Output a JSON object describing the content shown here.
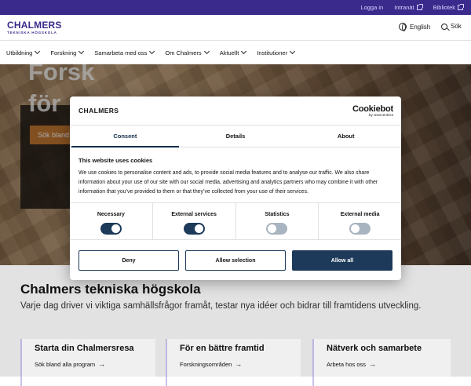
{
  "topbar": {
    "links": [
      {
        "label": "Logga in"
      },
      {
        "label": "Intranät"
      },
      {
        "label": "Bibliotek"
      }
    ]
  },
  "header": {
    "logo_main": "CHALMERS",
    "logo_sub": "TEKNISKA HÖGSKOLA",
    "language": "English",
    "search": "Sök"
  },
  "nav": {
    "items": [
      {
        "label": "Utbildning"
      },
      {
        "label": "Forskning"
      },
      {
        "label": "Samarbeta med oss"
      },
      {
        "label": "Om Chalmers"
      },
      {
        "label": "Aktuellt"
      },
      {
        "label": "Institutioner"
      }
    ]
  },
  "hero": {
    "line1": "Forsk",
    "line2": "för ",
    "button": "Sök bland"
  },
  "intro": {
    "title": "Chalmers tekniska högskola",
    "text": "Varje dag driver vi viktiga samhällsfrågor framåt, testar nya idéer och bidrar till framtidens utveckling."
  },
  "cards": [
    {
      "title": "Starta din Chalmersresa",
      "link": "Sök bland alla program"
    },
    {
      "title": "För en bättre framtid",
      "link": "Forskningsområden"
    },
    {
      "title": "Nätverk och samarbete",
      "link": "Arbeta hos oss"
    }
  ],
  "cookie_dialog": {
    "brand": "CHALMERS",
    "provider_main": "Cookiebot",
    "provider_sub": "by Usercentrics",
    "tabs": [
      {
        "label": "Consent"
      },
      {
        "label": "Details"
      },
      {
        "label": "About"
      }
    ],
    "heading": "This website uses cookies",
    "body": "We use cookies to personalise content and ads, to provide social media features and to analyse our traffic. We also share information about your use of our site with our social media, advertising and analytics partners who may combine it with other information that you’ve provided to them or that they’ve collected from your use of their services.",
    "toggles": [
      {
        "label": "Necessary",
        "state": "on"
      },
      {
        "label": "External services",
        "state": "on"
      },
      {
        "label": "Statistics",
        "state": "off"
      },
      {
        "label": "External media",
        "state": "off"
      }
    ],
    "buttons": {
      "deny": "Deny",
      "allow_selection": "Allow selection",
      "allow_all": "Allow all"
    }
  },
  "colors": {
    "brand_purple": "#3a2a8c",
    "cookie_navy": "#1d3a5a",
    "hero_button": "#c27631"
  }
}
